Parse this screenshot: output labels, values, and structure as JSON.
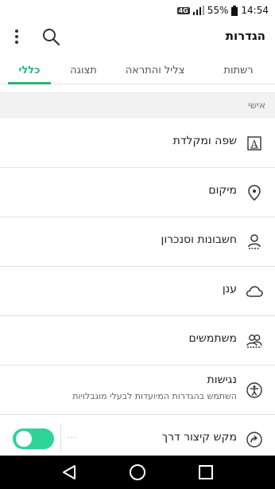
{
  "status_bar": {
    "network": "4G",
    "battery": "55%",
    "time": "14:54"
  },
  "app_bar": {
    "title": "הגדרות"
  },
  "tabs": [
    {
      "label": "כללי",
      "active": true
    },
    {
      "label": "תצוגה",
      "active": false
    },
    {
      "label": "צליל והתראה",
      "active": false
    },
    {
      "label": "רשתות",
      "active": false
    }
  ],
  "section": {
    "title": "אישי"
  },
  "items": [
    {
      "label": "שפה ומקלדת",
      "icon": "language-keyboard-icon"
    },
    {
      "label": "מיקום",
      "icon": "location-pin-icon"
    },
    {
      "label": "חשבונות וסנכרון",
      "icon": "accounts-sync-icon"
    },
    {
      "label": "ענן",
      "icon": "cloud-icon"
    },
    {
      "label": "משתמשים",
      "icon": "users-icon"
    },
    {
      "label": "נגישות",
      "subtitle": "השתמש בהגדרות המיועדות לבעלי מוגבלויות",
      "icon": "accessibility-icon"
    },
    {
      "label": "מקש קיצור דרך",
      "icon": "shortcut-key-icon",
      "toggle_on": true
    }
  ],
  "colors": {
    "accent": "#20b87a",
    "toggle": "#2fd39a"
  }
}
